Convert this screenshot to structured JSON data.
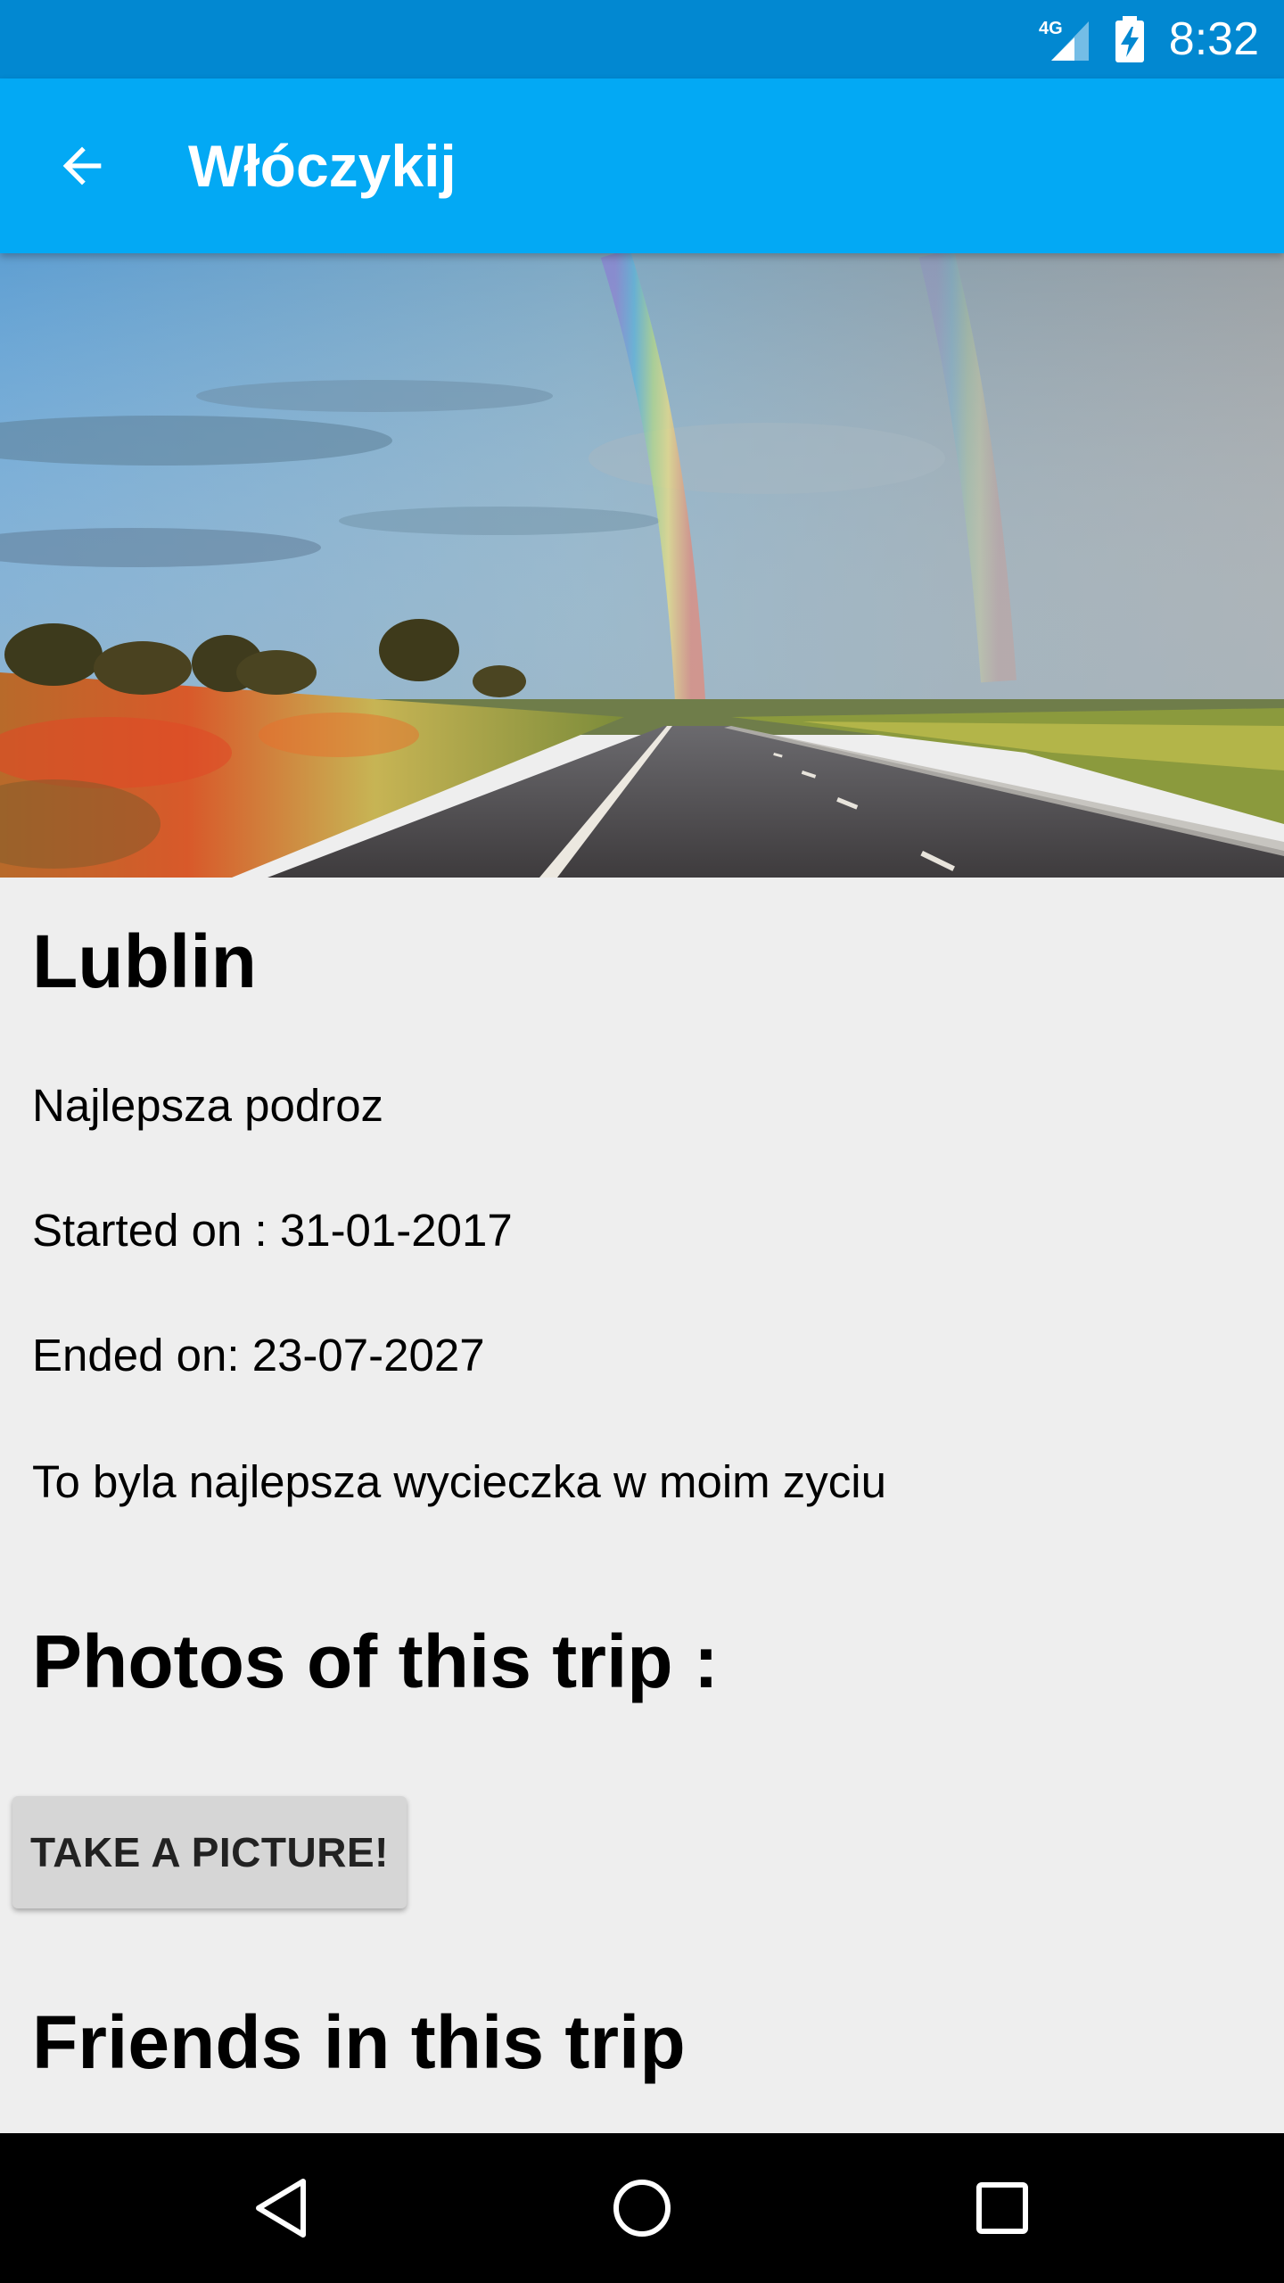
{
  "status_bar": {
    "network": "4G",
    "time": "8:32"
  },
  "app_bar": {
    "title": "Włóczykij",
    "back_icon": "arrow-back-icon"
  },
  "trip": {
    "city": "Lublin",
    "description": "Najlepsza podroz",
    "started": "Started on : 31-01-2017",
    "ended": "Ended on: 23-07-2027",
    "notes": "To byla najlepsza wycieczka w moim zyciu"
  },
  "photos_section": {
    "heading": "Photos of this trip :",
    "button_label": "TAKE A PICTURE!"
  },
  "friends_section": {
    "heading": "Friends in this trip"
  },
  "nav_bar": {
    "icons": [
      "back-triangle-icon",
      "home-circle-icon",
      "recents-square-icon"
    ]
  },
  "colors": {
    "status_bar": "#0288d1",
    "app_bar": "#03a9f4",
    "background": "#eeeeee"
  }
}
